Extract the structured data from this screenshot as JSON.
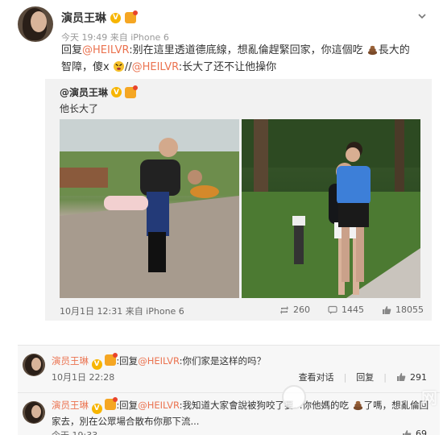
{
  "post": {
    "author": "演员王琳",
    "verified_badge": "V",
    "meta": "今天 19:49 来自 iPhone 6",
    "text_prefix": "回复",
    "mention1": "@HEILVR",
    "text_part1": ":别在這里透道德底線，想亂倫趕緊回家，你這個吃",
    "text_part2": "長大的智障，傻x",
    "text_part3": "//",
    "mention2": "@HEILVR",
    "text_part4": ":长大了还不让他操你"
  },
  "quote": {
    "author": "@演员王琳",
    "text": "他长大了",
    "photo1_alt": "photo-woman-hugging-boy",
    "photo2_alt": "photo-woman-and-boy-standing",
    "date": "10月1日 12:31 来自 iPhone 6",
    "reposts": "260",
    "comments": "1445",
    "likes": "18055"
  },
  "comments": [
    {
      "author": "演员王琳",
      "prefix": ":回复",
      "mention": "@HEILVR",
      "text": ":你们家是这样的吗？",
      "time": "10月1日 22:28",
      "action_view": "查看对话",
      "action_reply": "回复",
      "likes": "291"
    },
    {
      "author": "演员王琳",
      "prefix": ":回复",
      "mention": "@HEILVR",
      "text": ":我知道大家會說被狗咬了要...你他媽的吃",
      "text2": "了嗎，想亂倫回家去，別在公眾場合散布你那下流...",
      "time": "今天 19:33",
      "likes": "69"
    }
  ],
  "watermark": "网"
}
